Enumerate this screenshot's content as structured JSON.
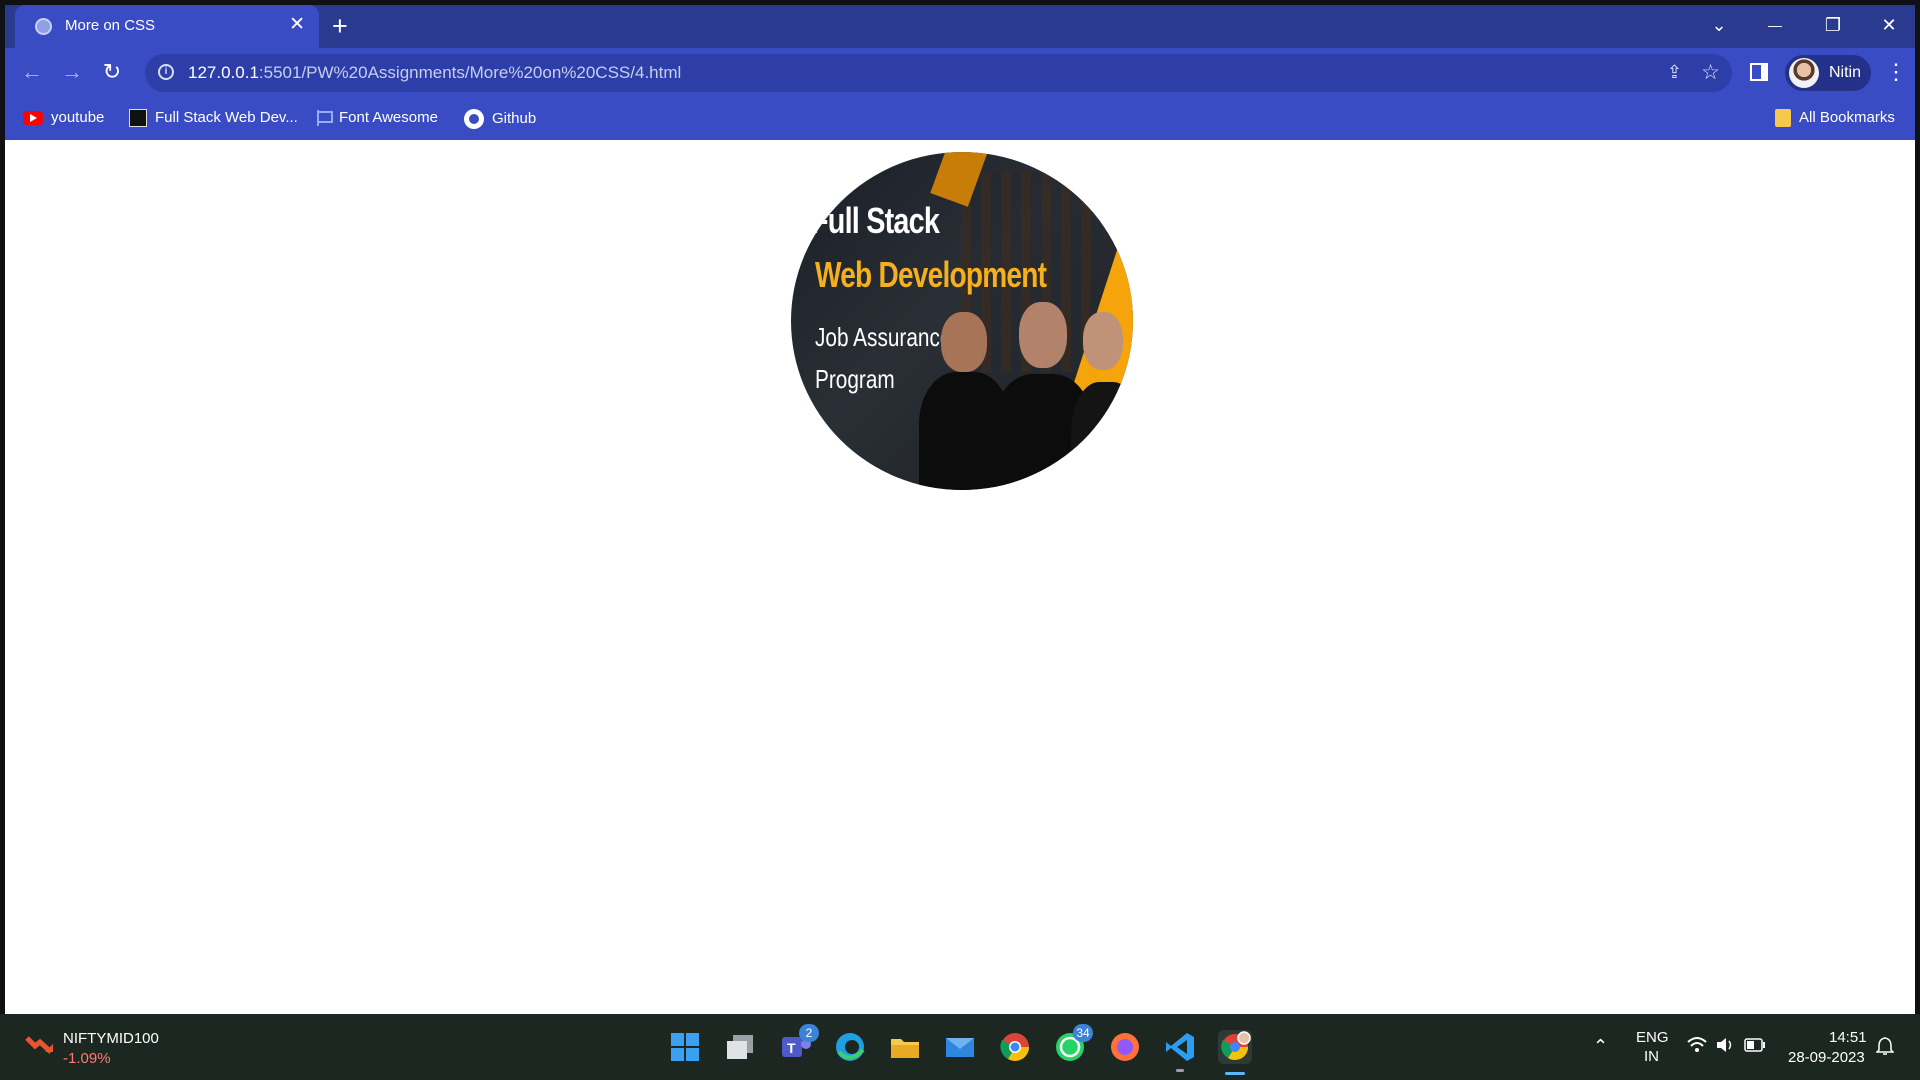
{
  "browser": {
    "tab_title": "More on CSS",
    "tab_close": "✕",
    "new_tab": "+",
    "url_host": "127.0.0.1",
    "url_path": ":5501/PW%20Assignments/More%20on%20CSS/4.html",
    "profile_name": "Nitin",
    "window_controls": {
      "tab_search": "⌄",
      "minimize": "—",
      "restore": "❐",
      "close": "✕"
    }
  },
  "bookmarks": {
    "items": [
      {
        "label": "youtube",
        "icon": "youtube-icon"
      },
      {
        "label": "Full Stack Web Dev...",
        "icon": "pw-skills-icon"
      },
      {
        "label": "Font Awesome",
        "icon": "flag-icon"
      },
      {
        "label": "Github",
        "icon": "github-icon"
      }
    ],
    "all_bookmarks": "All Bookmarks"
  },
  "page": {
    "promo_line1": "Full Stack",
    "promo_line2": "Web Development",
    "promo_line3": "Job Assurance",
    "promo_line4": "Program",
    "promo_colors": {
      "accent": "#f6b01e",
      "dark": "#1a1f27"
    }
  },
  "taskbar": {
    "stock_name": "NIFTYMID100",
    "stock_change": "-1.09%",
    "apps": [
      {
        "name": "start",
        "badge": ""
      },
      {
        "name": "task-view",
        "badge": ""
      },
      {
        "name": "teams",
        "badge": "2"
      },
      {
        "name": "edge",
        "badge": ""
      },
      {
        "name": "file-explorer",
        "badge": ""
      },
      {
        "name": "mail",
        "badge": ""
      },
      {
        "name": "chrome",
        "badge": ""
      },
      {
        "name": "whatsapp",
        "badge": "34"
      },
      {
        "name": "firefox",
        "badge": ""
      },
      {
        "name": "vscode",
        "badge": ""
      },
      {
        "name": "chrome-profile",
        "badge": ""
      }
    ],
    "lang_top": "ENG",
    "lang_bottom": "IN",
    "time": "14:51",
    "date": "28-09-2023"
  }
}
